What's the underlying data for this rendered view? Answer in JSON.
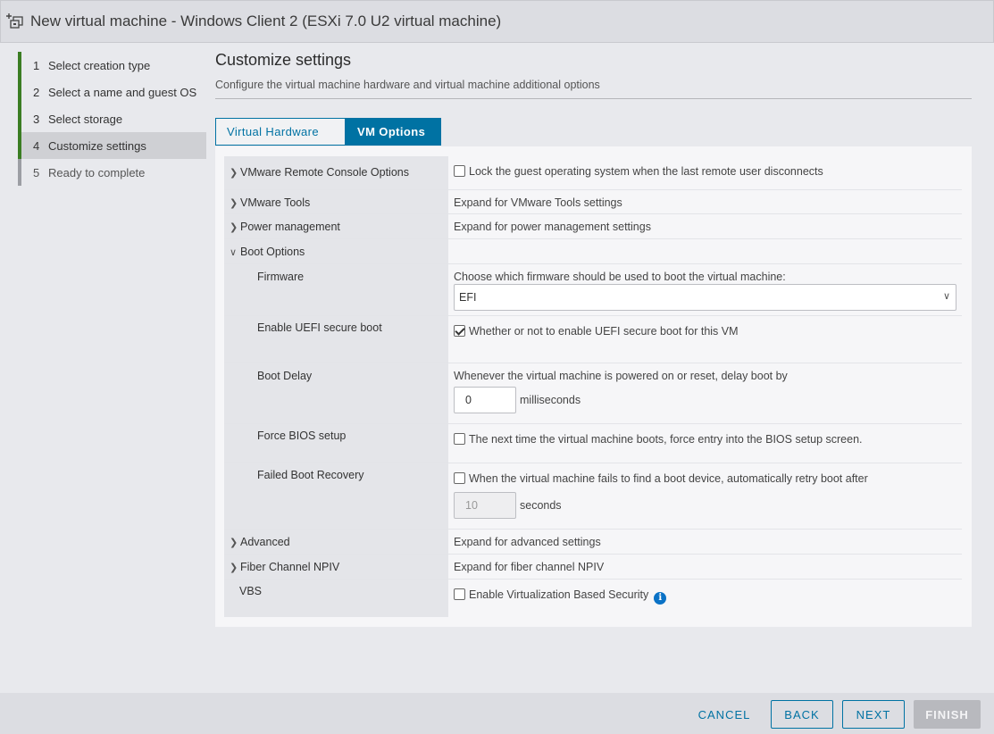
{
  "window": {
    "title": "New virtual machine - Windows Client 2 (ESXi 7.0 U2 virtual machine)"
  },
  "wizard": {
    "steps": [
      {
        "num": "1",
        "label": "Select creation type",
        "state": "done"
      },
      {
        "num": "2",
        "label": "Select a name and guest OS",
        "state": "done"
      },
      {
        "num": "3",
        "label": "Select storage",
        "state": "done"
      },
      {
        "num": "4",
        "label": "Customize settings",
        "state": "active"
      },
      {
        "num": "5",
        "label": "Ready to complete",
        "state": "pending"
      }
    ]
  },
  "main": {
    "title": "Customize settings",
    "subtitle": "Configure the virtual machine hardware and virtual machine additional options",
    "tabs": [
      {
        "label": "Virtual Hardware"
      },
      {
        "label": "VM Options"
      }
    ]
  },
  "options": {
    "remote_console": {
      "label": "VMware Remote Console Options",
      "value": "Lock the guest operating system when the last remote user disconnects",
      "checked": false
    },
    "tools": {
      "label": "VMware Tools",
      "value": "Expand for VMware Tools settings"
    },
    "power": {
      "label": "Power management",
      "value": "Expand for power management settings"
    },
    "boot": {
      "label": "Boot Options",
      "firmware": {
        "label": "Firmware",
        "desc": "Choose which firmware should be used to boot the virtual machine:",
        "selected": "EFI"
      },
      "secure_boot": {
        "label": "Enable UEFI secure boot",
        "value": "Whether or not to enable UEFI secure boot for this VM",
        "checked": true
      },
      "delay": {
        "label": "Boot Delay",
        "desc": "Whenever the virtual machine is powered on or reset, delay boot by",
        "value": "0",
        "unit": "milliseconds"
      },
      "force_bios": {
        "label": "Force BIOS setup",
        "value": "The next time the virtual machine boots, force entry into the BIOS setup screen.",
        "checked": false
      },
      "recovery": {
        "label": "Failed Boot Recovery",
        "value": "When the virtual machine fails to find a boot device, automatically retry boot after",
        "checked": false,
        "seconds": "10",
        "unit": "seconds"
      }
    },
    "advanced": {
      "label": "Advanced",
      "value": "Expand for advanced settings"
    },
    "npiv": {
      "label": "Fiber Channel NPIV",
      "value": "Expand for fiber channel NPIV"
    },
    "vbs": {
      "label": "VBS",
      "value": "Enable Virtualization Based Security",
      "checked": false
    }
  },
  "footer": {
    "cancel": "CANCEL",
    "back": "BACK",
    "next": "NEXT",
    "finish": "FINISH"
  },
  "colors": {
    "accent": "#0072a3",
    "step_done": "#3b7d23",
    "info": "#0a72c6"
  }
}
